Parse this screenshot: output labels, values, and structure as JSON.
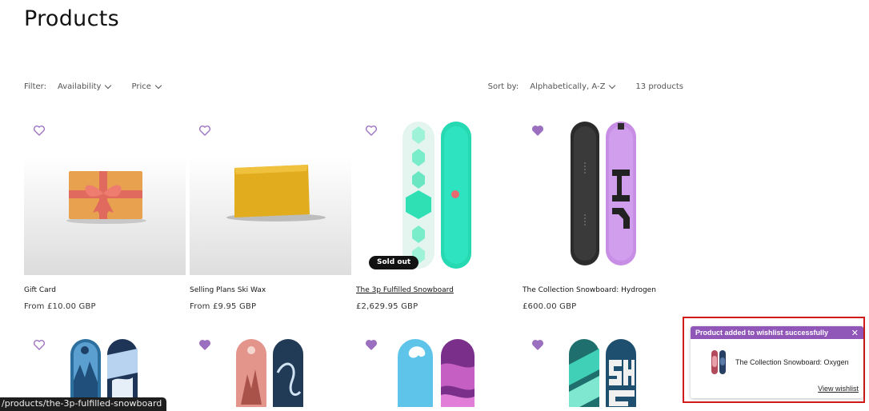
{
  "page": {
    "title": "Products"
  },
  "filters": {
    "label": "Filter:",
    "availability": "Availability",
    "price": "Price",
    "sort_label": "Sort by:",
    "sort_value": "Alphabetically, A-Z",
    "count": "13 products"
  },
  "products": [
    {
      "name": "Gift Card",
      "price": "From £10.00 GBP",
      "wishlisted": false
    },
    {
      "name": "Selling Plans Ski Wax",
      "price": "From £9.95 GBP",
      "wishlisted": false
    },
    {
      "name": "The 3p Fulfilled Snowboard",
      "price": "£2,629.95 GBP",
      "badge": "Sold out",
      "wishlisted": false
    },
    {
      "name": "The Collection Snowboard: Hydrogen",
      "price": "£600.00 GBP",
      "wishlisted": true
    },
    {
      "wishlisted": false
    },
    {
      "wishlisted": true
    },
    {
      "wishlisted": true
    },
    {
      "wishlisted": true
    }
  ],
  "status_bar": {
    "url": "/products/the-3p-fulfilled-snowboard"
  },
  "toast": {
    "title": "Product added to wishlist successfully",
    "close": "✕",
    "product": "The Collection Snowboard: Oxygen",
    "link": "View wishlist"
  },
  "colors": {
    "wishlist": "#9b6fc0",
    "toast_header": "#9157b8",
    "highlight": "#d11b1b"
  }
}
